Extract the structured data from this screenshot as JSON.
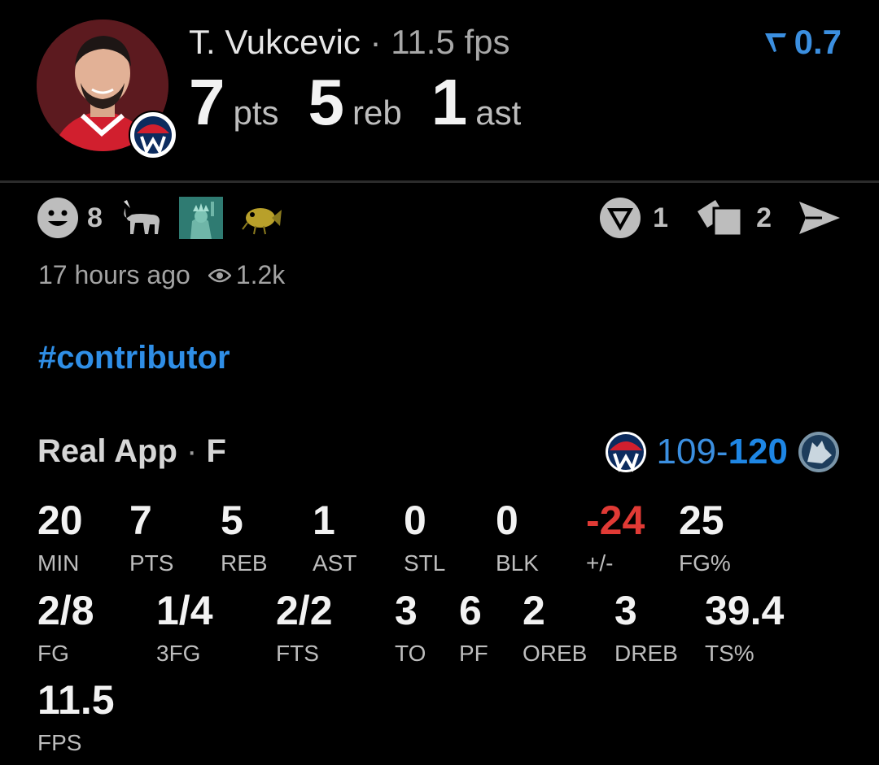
{
  "header": {
    "player_name": "T. Vukcevic",
    "separator": "·",
    "fps": "11.5 fps",
    "rating_value": "0.7",
    "rating_icon": "filter-arrow-icon",
    "statline": [
      {
        "value": "7",
        "unit": "pts"
      },
      {
        "value": "5",
        "unit": "reb"
      },
      {
        "value": "1",
        "unit": "ast"
      }
    ]
  },
  "reactions": {
    "emoji_count": "8",
    "icons": [
      "smiley-face-icon",
      "goat-icon",
      "statue-of-liberty-icon",
      "fish-bug-icon"
    ],
    "real_count": "1",
    "cards_count": "2"
  },
  "meta": {
    "time_ago": "17 hours ago",
    "views": "1.2k"
  },
  "hashtag": "#contributor",
  "game": {
    "source": "Real App",
    "dot": "·",
    "status": "F",
    "score_left": "109",
    "score_dash": "-",
    "score_right": "120"
  },
  "box_row1": [
    {
      "value": "20",
      "label": "MIN"
    },
    {
      "value": "7",
      "label": "PTS"
    },
    {
      "value": "5",
      "label": "REB"
    },
    {
      "value": "1",
      "label": "AST"
    },
    {
      "value": "0",
      "label": "STL"
    },
    {
      "value": "0",
      "label": "BLK"
    },
    {
      "value": "-24",
      "label": "+/-"
    },
    {
      "value": "25",
      "label": "FG%"
    }
  ],
  "box_row2": [
    {
      "value": "2/8",
      "label": "FG"
    },
    {
      "value": "1/4",
      "label": "3FG"
    },
    {
      "value": "2/2",
      "label": "FTS"
    },
    {
      "value": "3",
      "label": "TO"
    },
    {
      "value": "6",
      "label": "PF"
    },
    {
      "value": "2",
      "label": "OREB"
    },
    {
      "value": "3",
      "label": "DREB"
    },
    {
      "value": "39.4",
      "label": "TS%"
    }
  ],
  "box_row3": [
    {
      "value": "11.5",
      "label": "FPS"
    }
  ],
  "colors": {
    "accent_blue": "#2f8ee6",
    "negative_red": "#e03a35",
    "background": "#000000"
  }
}
